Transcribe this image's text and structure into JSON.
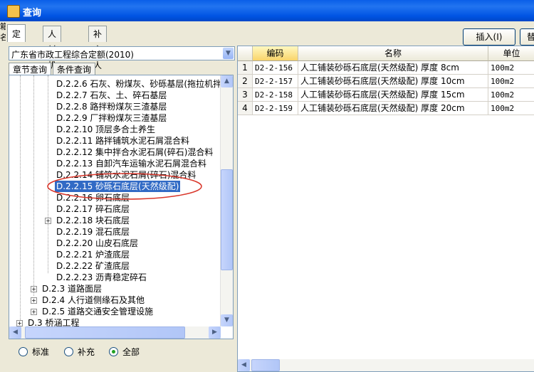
{
  "window": {
    "title": "查询"
  },
  "left_strip": [
    "箱",
    "名"
  ],
  "top_tabs": [
    "定额",
    "人材机",
    "补充人材机"
  ],
  "buttons": {
    "insert": "插入(I)",
    "replace": "替"
  },
  "combo": {
    "selected": "广东省市政工程综合定额(2010)"
  },
  "left_tabs": [
    "章节查询",
    "条件查询"
  ],
  "tree": [
    {
      "label": "D.2.2.6 石灰、粉煤灰、砂砾基层(拖拉机拌",
      "level": 2,
      "expander": false,
      "selected": false
    },
    {
      "label": "D.2.2.7 石灰、土、碎石基层",
      "level": 2,
      "expander": false,
      "selected": false
    },
    {
      "label": "D.2.2.8 路拌粉煤灰三渣基层",
      "level": 2,
      "expander": false,
      "selected": false
    },
    {
      "label": "D.2.2.9 厂拌粉煤灰三渣基层",
      "level": 2,
      "expander": false,
      "selected": false
    },
    {
      "label": "D.2.2.10 顶层多合土养生",
      "level": 2,
      "expander": false,
      "selected": false
    },
    {
      "label": "D.2.2.11 路拌铺筑水泥石屑混合料",
      "level": 2,
      "expander": false,
      "selected": false
    },
    {
      "label": "D.2.2.12 集中拌合水泥石屑(碎石)混合料",
      "level": 2,
      "expander": false,
      "selected": false
    },
    {
      "label": "D.2.2.13 自卸汽车运输水泥石屑混合料",
      "level": 2,
      "expander": false,
      "selected": false
    },
    {
      "label": "D.2.2.14 铺筑水泥石屑(碎石)混合料",
      "level": 2,
      "expander": false,
      "selected": false
    },
    {
      "label": "D.2.2.15 砂砾石底层(天然级配)",
      "level": 2,
      "expander": false,
      "selected": true
    },
    {
      "label": "D.2.2.16 卵石底层",
      "level": 2,
      "expander": false,
      "selected": false
    },
    {
      "label": "D.2.2.17 碎石底层",
      "level": 2,
      "expander": false,
      "selected": false
    },
    {
      "label": "D.2.2.18 块石底层",
      "level": 2,
      "expander": true,
      "selected": false
    },
    {
      "label": "D.2.2.19 混石底层",
      "level": 2,
      "expander": false,
      "selected": false
    },
    {
      "label": "D.2.2.20 山皮石底层",
      "level": 2,
      "expander": false,
      "selected": false
    },
    {
      "label": "D.2.2.21 炉渣底层",
      "level": 2,
      "expander": false,
      "selected": false
    },
    {
      "label": "D.2.2.22 矿渣底层",
      "level": 2,
      "expander": false,
      "selected": false
    },
    {
      "label": "D.2.2.23 沥青稳定碎石",
      "level": 2,
      "expander": false,
      "selected": false
    },
    {
      "label": "D.2.3 道路面层",
      "level": 1,
      "expander": true,
      "selected": false
    },
    {
      "label": "D.2.4 人行道侧缘石及其他",
      "level": 1,
      "expander": true,
      "selected": false
    },
    {
      "label": "D.2.5 道路交通安全管理设施",
      "level": 1,
      "expander": true,
      "selected": false
    },
    {
      "label": "D.3 桥涵工程",
      "level": 0,
      "expander": true,
      "selected": false
    }
  ],
  "filters": [
    {
      "label": "标准",
      "checked": false
    },
    {
      "label": "补充",
      "checked": false
    },
    {
      "label": "全部",
      "checked": true
    }
  ],
  "grid": {
    "columns": [
      "",
      "编码",
      "名称",
      "单位"
    ],
    "rows": [
      {
        "n": "1",
        "code": "D2-2-156",
        "name": "人工铺装砂砾石底层(天然级配) 厚度 8cm",
        "unit": "100m2"
      },
      {
        "n": "2",
        "code": "D2-2-157",
        "name": "人工铺装砂砾石底层(天然级配) 厚度 10cm",
        "unit": "100m2"
      },
      {
        "n": "3",
        "code": "D2-2-158",
        "name": "人工铺装砂砾石底层(天然级配) 厚度 15cm",
        "unit": "100m2"
      },
      {
        "n": "4",
        "code": "D2-2-159",
        "name": "人工铺装砂砾石底层(天然级配) 厚度 20cm",
        "unit": "100m2"
      }
    ]
  },
  "colors": {
    "title_bar": "#0054e3",
    "selection": "#316ac5",
    "highlight_header": "#f9d46a",
    "annotation": "#d9372b"
  }
}
